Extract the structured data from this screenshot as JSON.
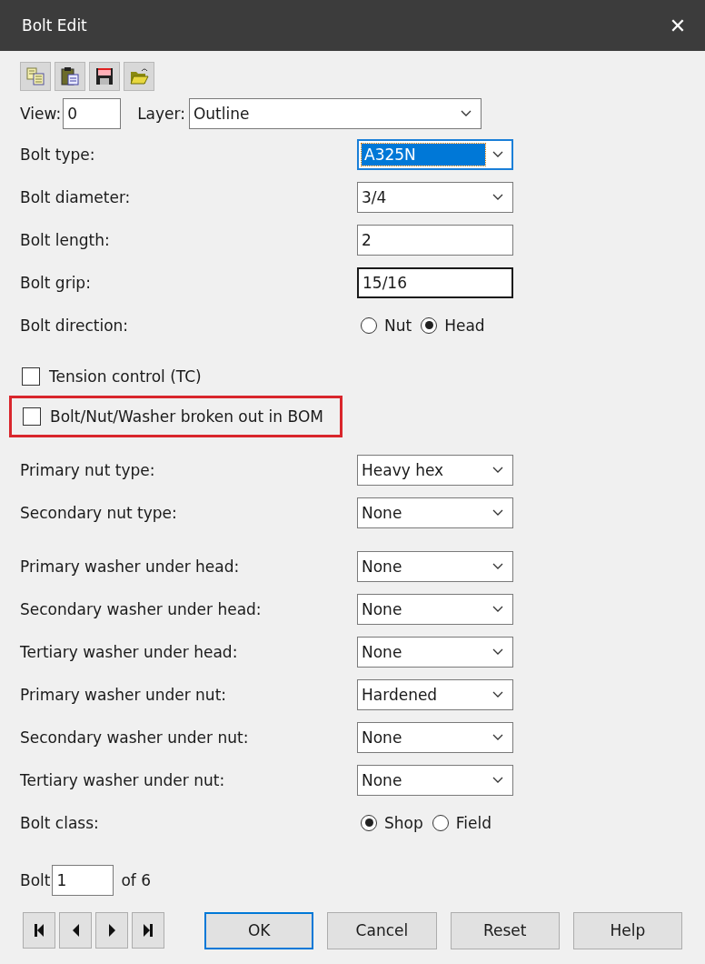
{
  "window": {
    "title": "Bolt Edit",
    "close": "✕"
  },
  "toolbar": [
    {
      "kind": "copy"
    },
    {
      "kind": "paste"
    },
    {
      "kind": "save"
    },
    {
      "kind": "open"
    }
  ],
  "view": {
    "label": "View:",
    "value": "0"
  },
  "layer": {
    "label": "Layer:",
    "value": "Outline"
  },
  "sections": [
    {
      "rows": [
        {
          "kind": "combo",
          "label": "Bolt type:",
          "value": "A325N",
          "focused": true
        },
        {
          "kind": "combo",
          "label": "Bolt diameter:",
          "value": "3/4",
          "focused": false
        },
        {
          "kind": "text",
          "label": "Bolt length:",
          "value": "2",
          "focused": false
        },
        {
          "kind": "text",
          "label": "Bolt grip:",
          "value": "15/16",
          "focused": true
        },
        {
          "kind": "radio",
          "label": "Bolt direction:",
          "options": [
            {
              "label": "Nut",
              "selected": false
            },
            {
              "label": "Head",
              "selected": true
            }
          ]
        }
      ]
    },
    {
      "rows": [
        {
          "kind": "checkbox",
          "label": "Tension control (TC)",
          "checked": false,
          "outlined": false
        },
        {
          "kind": "checkbox",
          "label": "Bolt/Nut/Washer broken out in BOM",
          "checked": false,
          "outlined": true
        }
      ]
    },
    {
      "rows": [
        {
          "kind": "combo",
          "label": "Primary nut type:",
          "value": "Heavy hex",
          "focused": false
        },
        {
          "kind": "combo",
          "label": "Secondary nut type:",
          "value": "None",
          "focused": false
        }
      ]
    },
    {
      "rows": [
        {
          "kind": "combo",
          "label": "Primary washer under head:",
          "value": "None",
          "focused": false
        },
        {
          "kind": "combo",
          "label": "Secondary washer under head:",
          "value": "None",
          "focused": false
        },
        {
          "kind": "combo",
          "label": "Tertiary washer under head:",
          "value": "None",
          "focused": false
        },
        {
          "kind": "combo",
          "label": "Primary washer under nut:",
          "value": "Hardened",
          "focused": false
        },
        {
          "kind": "combo",
          "label": "Secondary washer under nut:",
          "value": "None",
          "focused": false
        },
        {
          "kind": "combo",
          "label": "Tertiary washer under nut:",
          "value": "None",
          "focused": false
        },
        {
          "kind": "radio",
          "label": "Bolt class:",
          "options": [
            {
              "label": "Shop",
              "selected": true
            },
            {
              "label": "Field",
              "selected": false
            }
          ]
        }
      ]
    }
  ],
  "bolt": {
    "label": "Bolt",
    "value": "1",
    "of": "of 6"
  },
  "navigation": [
    {
      "kind": "first"
    },
    {
      "kind": "previous"
    },
    {
      "kind": "next"
    },
    {
      "kind": "last"
    }
  ],
  "buttons": [
    {
      "label": "OK",
      "default": true
    },
    {
      "label": "Cancel",
      "default": false
    },
    {
      "label": "Reset",
      "default": false
    },
    {
      "label": "Help",
      "default": false
    }
  ]
}
